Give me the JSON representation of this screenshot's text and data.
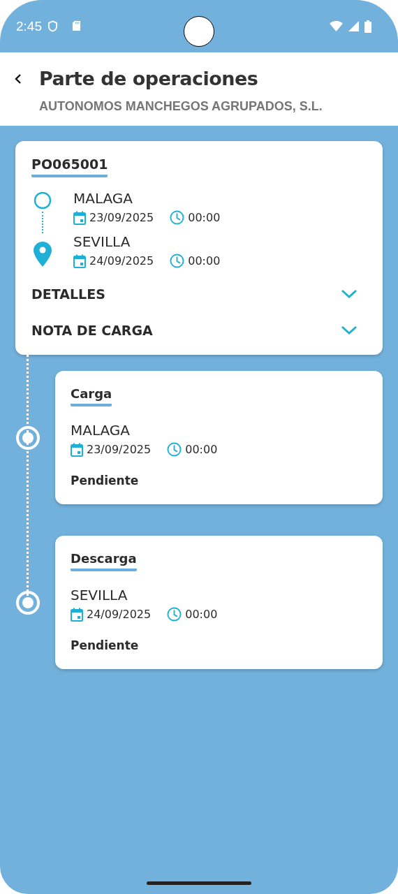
{
  "status_bar": {
    "time": "2:45"
  },
  "header": {
    "title": "Parte de operaciones",
    "subtitle": "AUTONOMOS MANCHEGOS AGRUPADOS, S.L."
  },
  "order": {
    "code": "PO065001",
    "route": [
      {
        "kind": "origin",
        "city": "MALAGA",
        "date": "23/09/2025",
        "time": "00:00"
      },
      {
        "kind": "destination",
        "city": "SEVILLA",
        "date": "24/09/2025",
        "time": "00:00"
      }
    ],
    "sections": [
      {
        "label": "DETALLES",
        "expanded": false
      },
      {
        "label": "NOTA DE CARGA",
        "expanded": false
      }
    ]
  },
  "stops": [
    {
      "type": "Carga",
      "city": "MALAGA",
      "date": "23/09/2025",
      "time": "00:00",
      "status": "Pendiente"
    },
    {
      "type": "Descarga",
      "city": "SEVILLA",
      "date": "24/09/2025",
      "time": "00:00",
      "status": "Pendiente"
    }
  ]
}
